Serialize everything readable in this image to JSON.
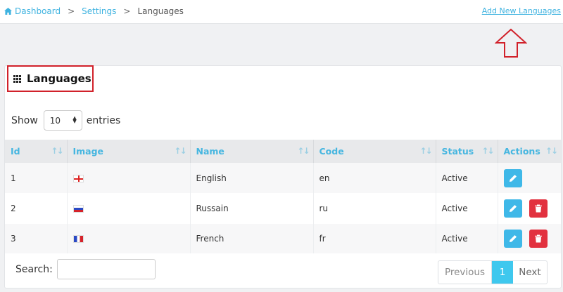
{
  "breadcrumb": {
    "home": "Dashboard",
    "settings": "Settings",
    "current": "Languages",
    "separator": ">"
  },
  "header": {
    "add_link": "Add New Languages"
  },
  "card": {
    "title": "Languages"
  },
  "length": {
    "prefix": "Show",
    "value": "10",
    "suffix": "entries"
  },
  "table": {
    "columns": [
      "Id",
      "Image",
      "Name",
      "Code",
      "Status",
      "Actions"
    ],
    "rows": [
      {
        "id": "1",
        "flag": "england-flag",
        "name": "English",
        "code": "en",
        "status": "Active"
      },
      {
        "id": "2",
        "flag": "russia-flag",
        "name": "Russain",
        "code": "ru",
        "status": "Active"
      },
      {
        "id": "3",
        "flag": "france-flag",
        "name": "French",
        "code": "fr",
        "status": "Active"
      }
    ]
  },
  "search": {
    "label": "Search:",
    "value": ""
  },
  "pagination": {
    "previous": "Previous",
    "current": "1",
    "next": "Next"
  },
  "colors": {
    "accent": "#3fb3e0",
    "edit_button": "#3fb8e8",
    "delete_button": "#e2313f",
    "highlight_border": "#d1212a"
  }
}
